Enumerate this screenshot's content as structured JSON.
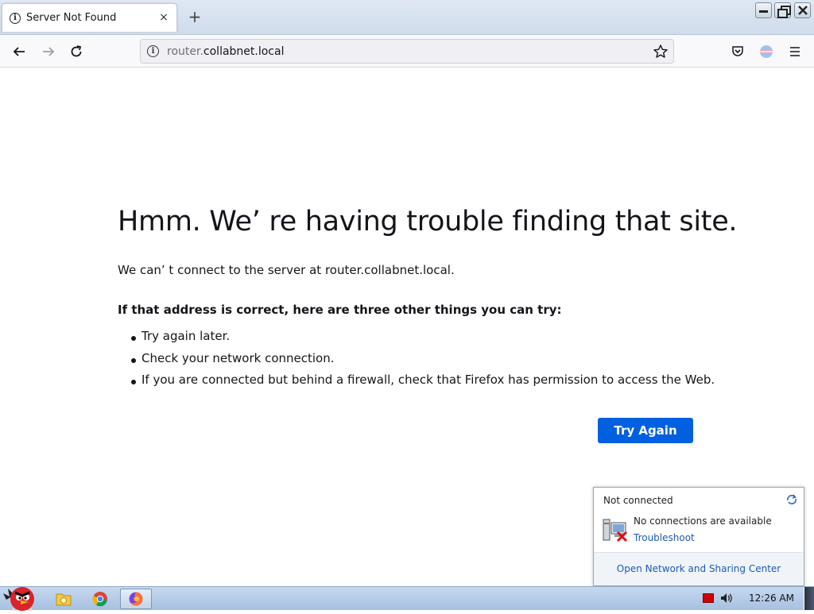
{
  "browser": {
    "tab": {
      "title": "Server Not Found",
      "close_glyph": "×",
      "icon": "info-icon"
    },
    "new_tab_glyph": "+",
    "url": {
      "subdomain": "router.",
      "domain": "collabnet.local"
    }
  },
  "page": {
    "title": "Hmm. We’  re having trouble finding that site.",
    "description": "We can’  t connect to the server at router.collabnet.local.",
    "try_heading": "If that address is correct, here are three other things you can try:",
    "suggestions": [
      "Try again later.",
      "Check your network connection.",
      "If you are connected but behind a firewall, check that Firefox has permission to access the Web."
    ],
    "try_again_label": "Try Again",
    "accent_color": "#0060df"
  },
  "network_flyout": {
    "status": "Not connected",
    "message": "No connections are available",
    "troubleshoot": "Troubleshoot",
    "open_center": "Open Network and Sharing Center"
  },
  "taskbar": {
    "clock": "12:26 AM"
  }
}
